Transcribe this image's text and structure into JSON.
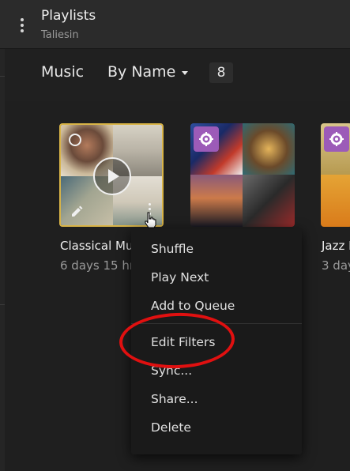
{
  "header": {
    "title": "Playlists",
    "subtitle": "Taliesin"
  },
  "toolbar": {
    "section": "Music",
    "sort_label": "By Name",
    "count": "8"
  },
  "cards": [
    {
      "title": "Classical Mu",
      "meta": "6 days 15 hr"
    },
    {
      "title": "",
      "meta": ""
    },
    {
      "title": "Jazz I",
      "meta": "3 day"
    }
  ],
  "context_menu": {
    "items": [
      "Shuffle",
      "Play Next",
      "Add to Queue",
      "Edit Filters",
      "Sync...",
      "Share...",
      "Delete"
    ]
  },
  "colors": {
    "selected_border": "#d9b447",
    "smart_badge": "#9c5bb8",
    "annotation": "#e01010"
  }
}
